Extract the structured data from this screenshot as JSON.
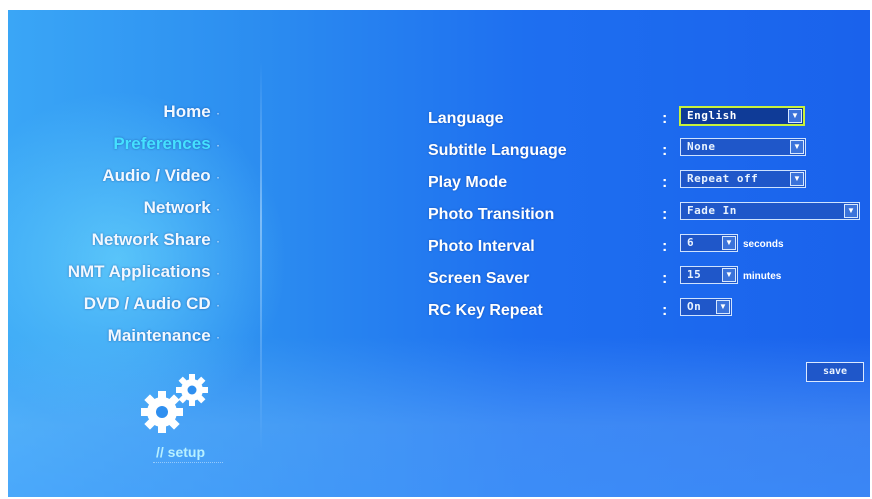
{
  "menu": {
    "items": [
      {
        "label": "Home"
      },
      {
        "label": "Preferences"
      },
      {
        "label": "Audio / Video"
      },
      {
        "label": "Network"
      },
      {
        "label": "Network Share"
      },
      {
        "label": "NMT Applications"
      },
      {
        "label": "DVD / Audio CD"
      },
      {
        "label": "Maintenance"
      }
    ],
    "bullet": "·"
  },
  "footer": {
    "label": "// setup"
  },
  "colors": {
    "accent": "#45e0ff",
    "focus": "#c8f23c",
    "background": "#1e6ff0"
  },
  "icons": {
    "setup": "gear-icon",
    "dropdown": "chevron-down-icon"
  },
  "settings": {
    "colon": ":",
    "rows": [
      {
        "label": "Language",
        "value": "English"
      },
      {
        "label": "Subtitle Language",
        "value": "None"
      },
      {
        "label": "Play Mode",
        "value": "Repeat off"
      },
      {
        "label": "Photo Transition",
        "value": "Fade In"
      },
      {
        "label": "Photo Interval",
        "value": "6",
        "unit": "seconds"
      },
      {
        "label": "Screen Saver",
        "value": "15",
        "unit": "minutes"
      },
      {
        "label": "RC Key Repeat",
        "value": "On"
      }
    ]
  },
  "actions": {
    "save_label": "save"
  }
}
